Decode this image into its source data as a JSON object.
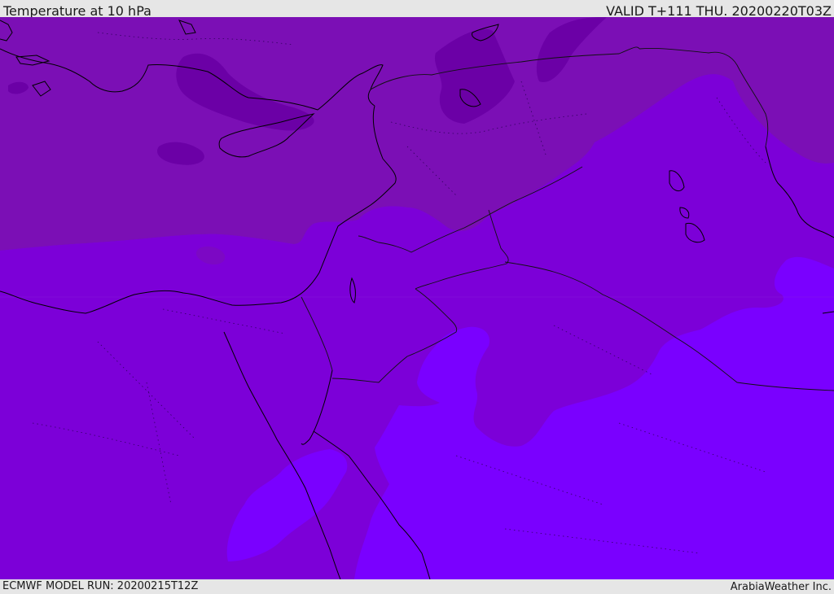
{
  "header": {
    "title": "Temperature at 10 hPa",
    "valid": "VALID T+111 THU. 20200220T03Z"
  },
  "footer": {
    "model_run": "ECMWF MODEL RUN: 20200215T12Z",
    "credit": "ArabiaWeather Inc."
  },
  "colors": {
    "band_coldest": "#6b00a6",
    "band_cold": "#7b0fb5",
    "band_mid": "#7c00d8",
    "band_warm": "#7a00ea",
    "band_warmest": "#7a00ff",
    "coastline": "#000000",
    "frame": "#e6e6e6"
  }
}
